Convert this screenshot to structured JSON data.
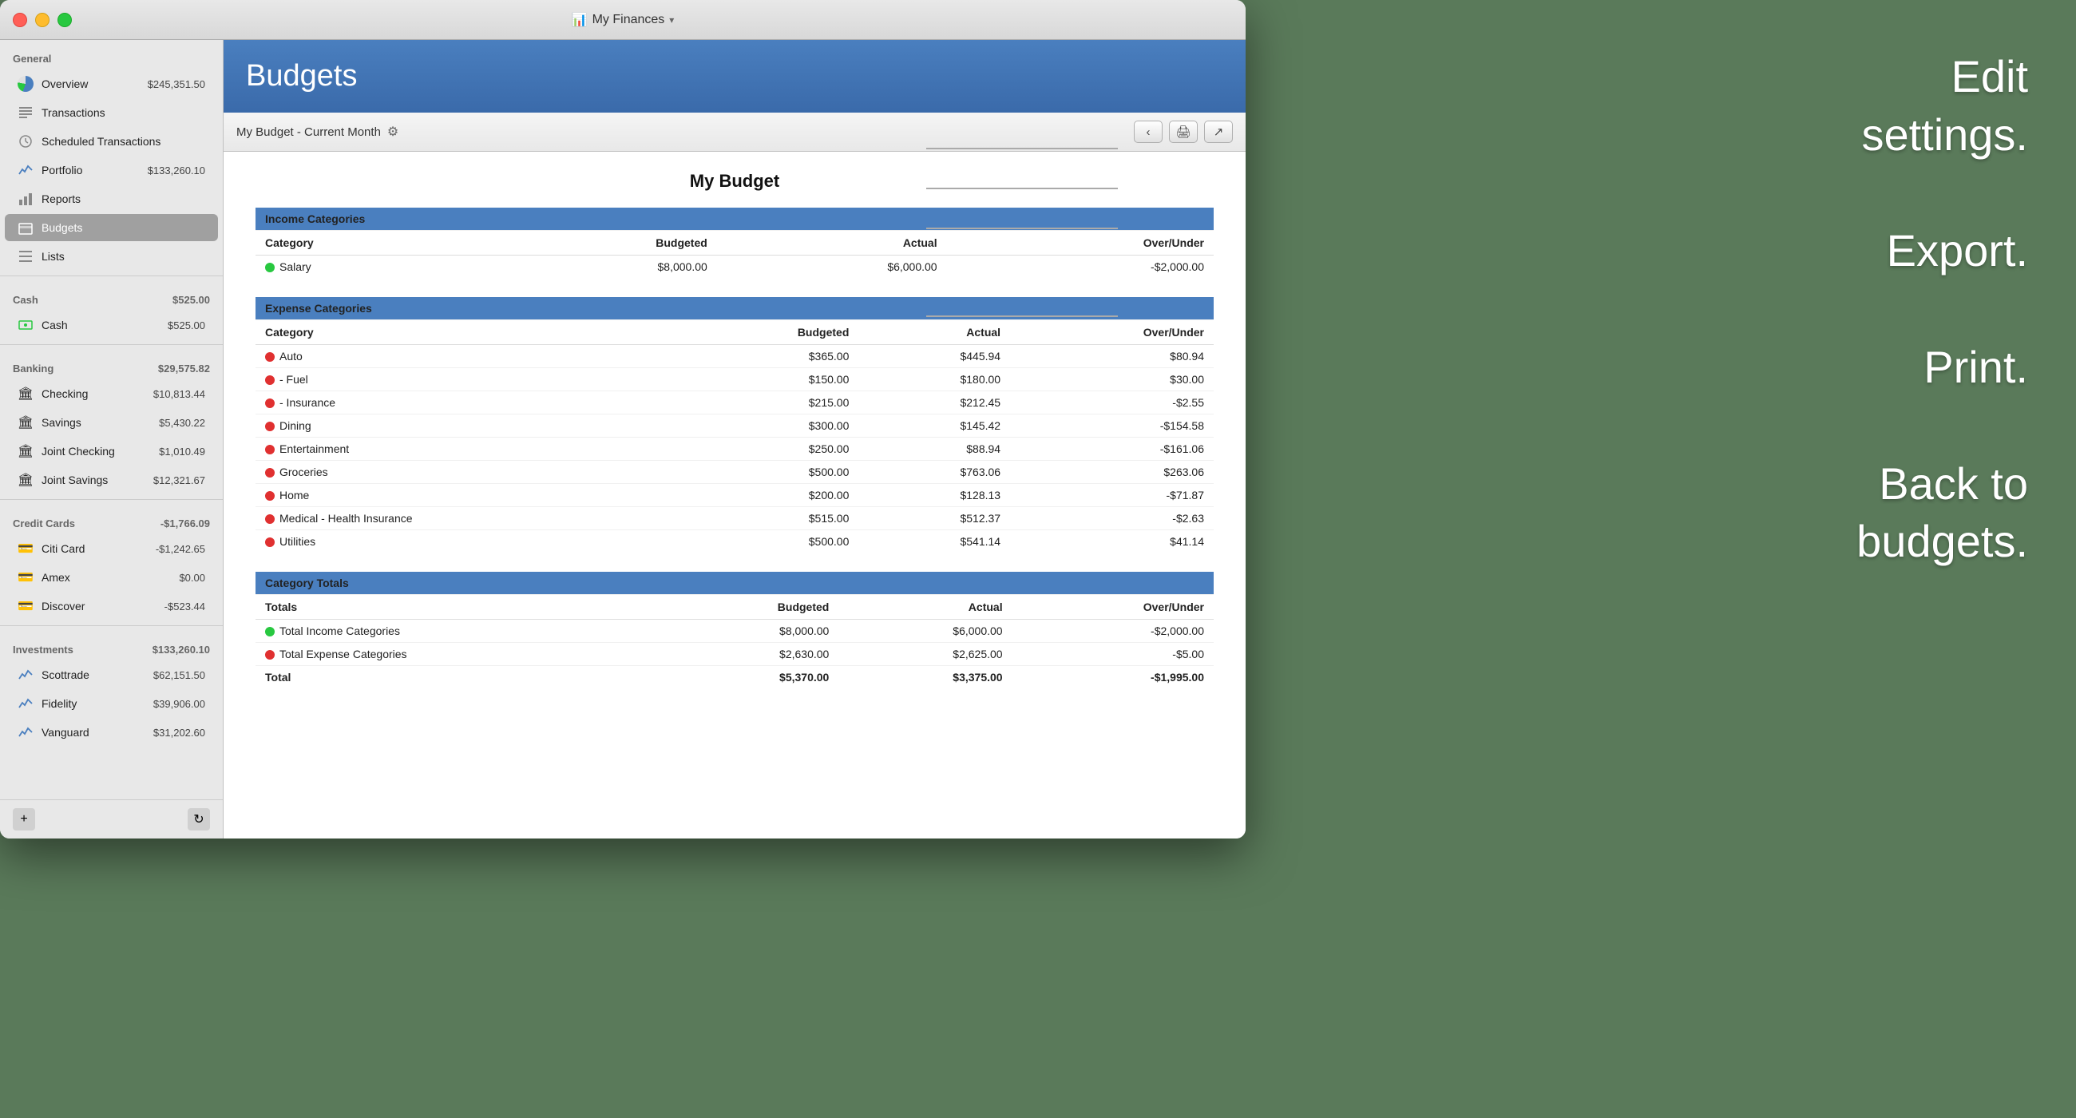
{
  "window": {
    "title": "My Finances",
    "title_icon": "💰"
  },
  "sidebar": {
    "general_label": "General",
    "cash_label": "Cash",
    "banking_label": "Banking",
    "credit_cards_label": "Credit Cards",
    "investments_label": "Investments",
    "general_items": [
      {
        "id": "overview",
        "label": "Overview",
        "value": "$245,351.50",
        "icon": "overview"
      },
      {
        "id": "transactions",
        "label": "Transactions",
        "value": "",
        "icon": "list"
      },
      {
        "id": "scheduled",
        "label": "Scheduled Transactions",
        "value": "",
        "icon": "clock"
      },
      {
        "id": "portfolio",
        "label": "Portfolio",
        "value": "$133,260.10",
        "icon": "chart"
      },
      {
        "id": "reports",
        "label": "Reports",
        "value": "",
        "icon": "bar"
      },
      {
        "id": "budgets",
        "label": "Budgets",
        "value": "",
        "icon": "budgets",
        "active": true
      },
      {
        "id": "lists",
        "label": "Lists",
        "value": "",
        "icon": "list2"
      }
    ],
    "cash_total": "$525.00",
    "cash_items": [
      {
        "label": "Cash",
        "value": "$525.00"
      }
    ],
    "banking_total": "$29,575.82",
    "banking_items": [
      {
        "label": "Checking",
        "value": "$10,813.44"
      },
      {
        "label": "Savings",
        "value": "$5,430.22"
      },
      {
        "label": "Joint Checking",
        "value": "$1,010.49"
      },
      {
        "label": "Joint Savings",
        "value": "$12,321.67"
      }
    ],
    "credit_total": "-$1,766.09",
    "credit_items": [
      {
        "label": "Citi Card",
        "value": "-$1,242.65"
      },
      {
        "label": "Amex",
        "value": "$0.00"
      },
      {
        "label": "Discover",
        "value": "-$523.44"
      }
    ],
    "investments_total": "$133,260.10",
    "investments_items": [
      {
        "label": "Scottrade",
        "value": "$62,151.50"
      },
      {
        "label": "Fidelity",
        "value": "$39,906.00"
      },
      {
        "label": "Vanguard",
        "value": "$31,202.60"
      }
    ]
  },
  "content": {
    "title": "Budgets",
    "toolbar_label": "My Budget - Current Month",
    "budget_title": "My Budget",
    "income_header": "Income Categories",
    "income_columns": [
      "Category",
      "Budgeted",
      "Actual",
      "Over/Under"
    ],
    "income_rows": [
      {
        "name": "Salary",
        "budgeted": "$8,000.00",
        "actual": "$6,000.00",
        "over_under": "-$2,000.00",
        "dot": "green"
      }
    ],
    "expense_header": "Expense Categories",
    "expense_columns": [
      "Category",
      "Budgeted",
      "Actual",
      "Over/Under"
    ],
    "expense_rows": [
      {
        "name": "Auto",
        "budgeted": "$365.00",
        "actual": "$445.94",
        "over_under": "$80.94",
        "dot": "red"
      },
      {
        "name": "- Fuel",
        "budgeted": "$150.00",
        "actual": "$180.00",
        "over_under": "$30.00",
        "dot": "red"
      },
      {
        "name": "- Insurance",
        "budgeted": "$215.00",
        "actual": "$212.45",
        "over_under": "-$2.55",
        "dot": "red"
      },
      {
        "name": "Dining",
        "budgeted": "$300.00",
        "actual": "$145.42",
        "over_under": "-$154.58",
        "dot": "red"
      },
      {
        "name": "Entertainment",
        "budgeted": "$250.00",
        "actual": "$88.94",
        "over_under": "-$161.06",
        "dot": "red"
      },
      {
        "name": "Groceries",
        "budgeted": "$500.00",
        "actual": "$763.06",
        "over_under": "$263.06",
        "dot": "red"
      },
      {
        "name": "Home",
        "budgeted": "$200.00",
        "actual": "$128.13",
        "over_under": "-$71.87",
        "dot": "red"
      },
      {
        "name": "Medical - Health Insurance",
        "budgeted": "$515.00",
        "actual": "$512.37",
        "over_under": "-$2.63",
        "dot": "red"
      },
      {
        "name": "Utilities",
        "budgeted": "$500.00",
        "actual": "$541.14",
        "over_under": "$41.14",
        "dot": "red"
      }
    ],
    "totals_header": "Category Totals",
    "totals_columns": [
      "Totals",
      "Budgeted",
      "Actual",
      "Over/Under"
    ],
    "totals_rows": [
      {
        "name": "Total Income Categories",
        "budgeted": "$8,000.00",
        "actual": "$6,000.00",
        "over_under": "-$2,000.00",
        "dot": "green"
      },
      {
        "name": "Total Expense Categories",
        "budgeted": "$2,630.00",
        "actual": "$2,625.00",
        "over_under": "-$5.00",
        "dot": "red"
      }
    ],
    "grand_total": {
      "label": "Total",
      "budgeted": "$5,370.00",
      "actual": "$3,375.00",
      "over_under": "-$1,995.00"
    }
  },
  "right_panel": {
    "line1": "Edit",
    "line2": "settings.",
    "line3": "Export.",
    "line4": "Print.",
    "line5": "Back to",
    "line6": "budgets."
  }
}
